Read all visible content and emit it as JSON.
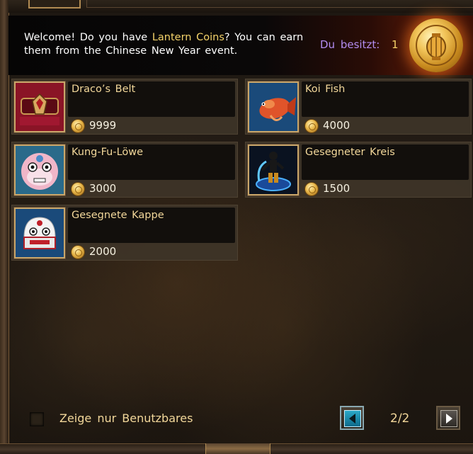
{
  "banner": {
    "welcome_prefix": "Welcome! Do you have ",
    "welcome_highlight": "Lantern Coins",
    "welcome_suffix": "? You can earn them from the Chinese New Year event.",
    "balance_label": "Du besitzt:",
    "balance_value": "1",
    "coin_icon": "lantern-coin-icon"
  },
  "items": [
    {
      "name": "Draco’s Belt",
      "price": "9999",
      "icon": "belt-icon"
    },
    {
      "name": "Koi Fish",
      "price": "4000",
      "icon": "koi-fish-icon"
    },
    {
      "name": "Kung-Fu-Löwe",
      "price": "3000",
      "icon": "lion-mask-icon"
    },
    {
      "name": "Gesegneter Kreis",
      "price": "1500",
      "icon": "blessed-circle-icon"
    },
    {
      "name": "Gesegnete Kappe",
      "price": "2000",
      "icon": "lion-cap-icon"
    }
  ],
  "footer": {
    "filter_label": "Zeige nur Benutzbares",
    "filter_checked": false,
    "page_indicator": "2/2",
    "prev_icon": "arrow-left-icon",
    "next_icon": "arrow-right-icon"
  },
  "colors": {
    "highlight": "#f5d36a",
    "balance_label": "#b28cf0",
    "item_name": "#f2d79a",
    "price": "#f5f0e0"
  }
}
